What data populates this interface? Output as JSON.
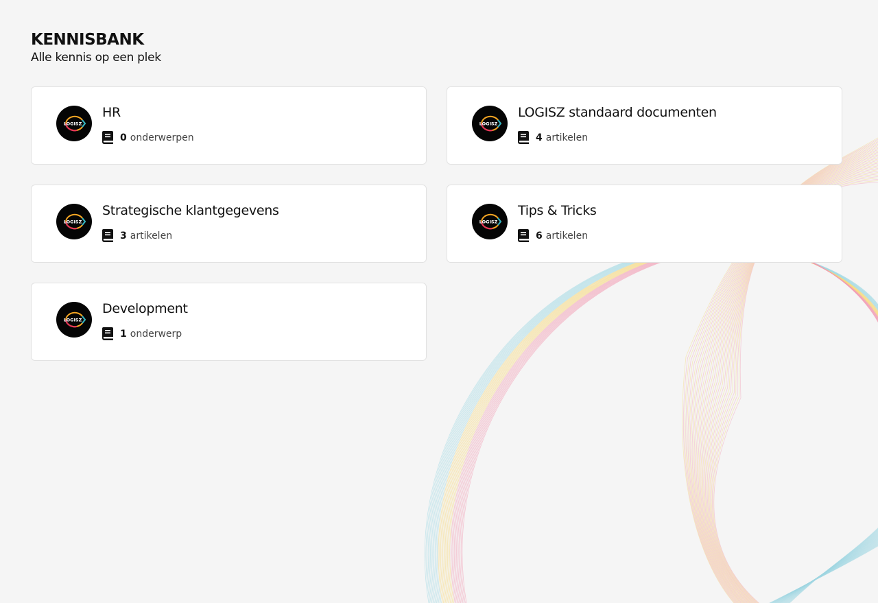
{
  "header": {
    "title": "KENNISBANK",
    "subtitle": "Alle kennis op een plek"
  },
  "logo": {
    "text": "LOGISZ",
    "icon": "logisz-logo-icon",
    "colors": [
      "#f5a623",
      "#e6325a",
      "#2bb3c6"
    ]
  },
  "categories": [
    {
      "title": "HR",
      "count": "0",
      "unit": "onderwerpen",
      "icon": "book-icon"
    },
    {
      "title": "LOGISZ standaard documenten",
      "count": "4",
      "unit": "artikelen",
      "icon": "book-icon"
    },
    {
      "title": "Strategische klantgegevens",
      "count": "3",
      "unit": "artikelen",
      "icon": "book-icon"
    },
    {
      "title": "Tips & Tricks",
      "count": "6",
      "unit": "artikelen",
      "icon": "book-icon"
    },
    {
      "title": "Development",
      "count": "1",
      "unit": "onderwerp",
      "icon": "book-icon"
    }
  ],
  "background": {
    "colors": [
      "#f7d774",
      "#f29bb3",
      "#9fd8e3"
    ]
  }
}
